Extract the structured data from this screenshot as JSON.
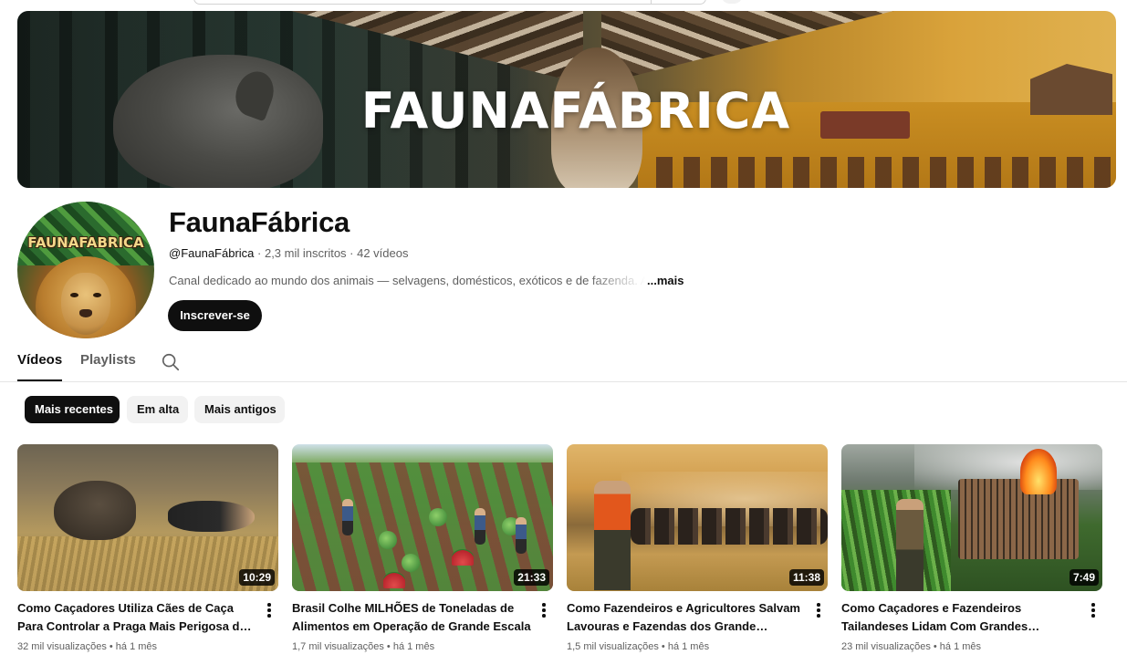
{
  "banner": {
    "brand_text": "FAUNAFÁBRICA"
  },
  "channel": {
    "avatar_text": "FAUNAFABRICA",
    "name": "FaunaFábrica",
    "handle": "@FaunaFábrica",
    "separator": " · ",
    "subscribers": "2,3 mil inscritos",
    "videos_count": "42 vídeos",
    "description": "Canal dedicado ao mundo dos animais — selvagens, domésticos, exóticos e de fazenda. A",
    "more_label": "...mais",
    "subscribe_label": "Inscrever-se"
  },
  "tabs": {
    "videos": "Vídeos",
    "playlists": "Playlists",
    "search_icon": "search-icon"
  },
  "chips": {
    "recent": "Mais recentes",
    "trending": "Em alta",
    "oldest": "Mais antigos",
    "selected": "recent"
  },
  "videos": [
    {
      "title": "Como Caçadores Utiliza Cães de Caça Para Controlar a Praga Mais Perigosa do Brasil",
      "duration": "10:29",
      "views": "32 mil visualizações",
      "age": "há 1 mês"
    },
    {
      "title": "Brasil Colhe MILHÕES de Toneladas de Alimentos em Operação de Grande Escala",
      "duration": "21:33",
      "views": "1,7 mil visualizações",
      "age": "há 1 mês"
    },
    {
      "title": "Como Fazendeiros e Agricultores Salvam Lavouras e Fazendas dos Grande Búfalo...",
      "duration": "11:38",
      "views": "1,5 mil visualizações",
      "age": "há 1 mês"
    },
    {
      "title": "Como Caçadores e Fazendeiros Tailandeses Lidam Com Grandes Babuínos Invasores e...",
      "duration": "7:49",
      "views": "23 mil visualizações",
      "age": "há 1 mês"
    }
  ],
  "meta_separator": " • ",
  "colors": {
    "text_primary": "#0f0f0f",
    "text_secondary": "#606060",
    "chip_bg": "#f2f2f2",
    "button_dark": "#0f0f0f"
  }
}
